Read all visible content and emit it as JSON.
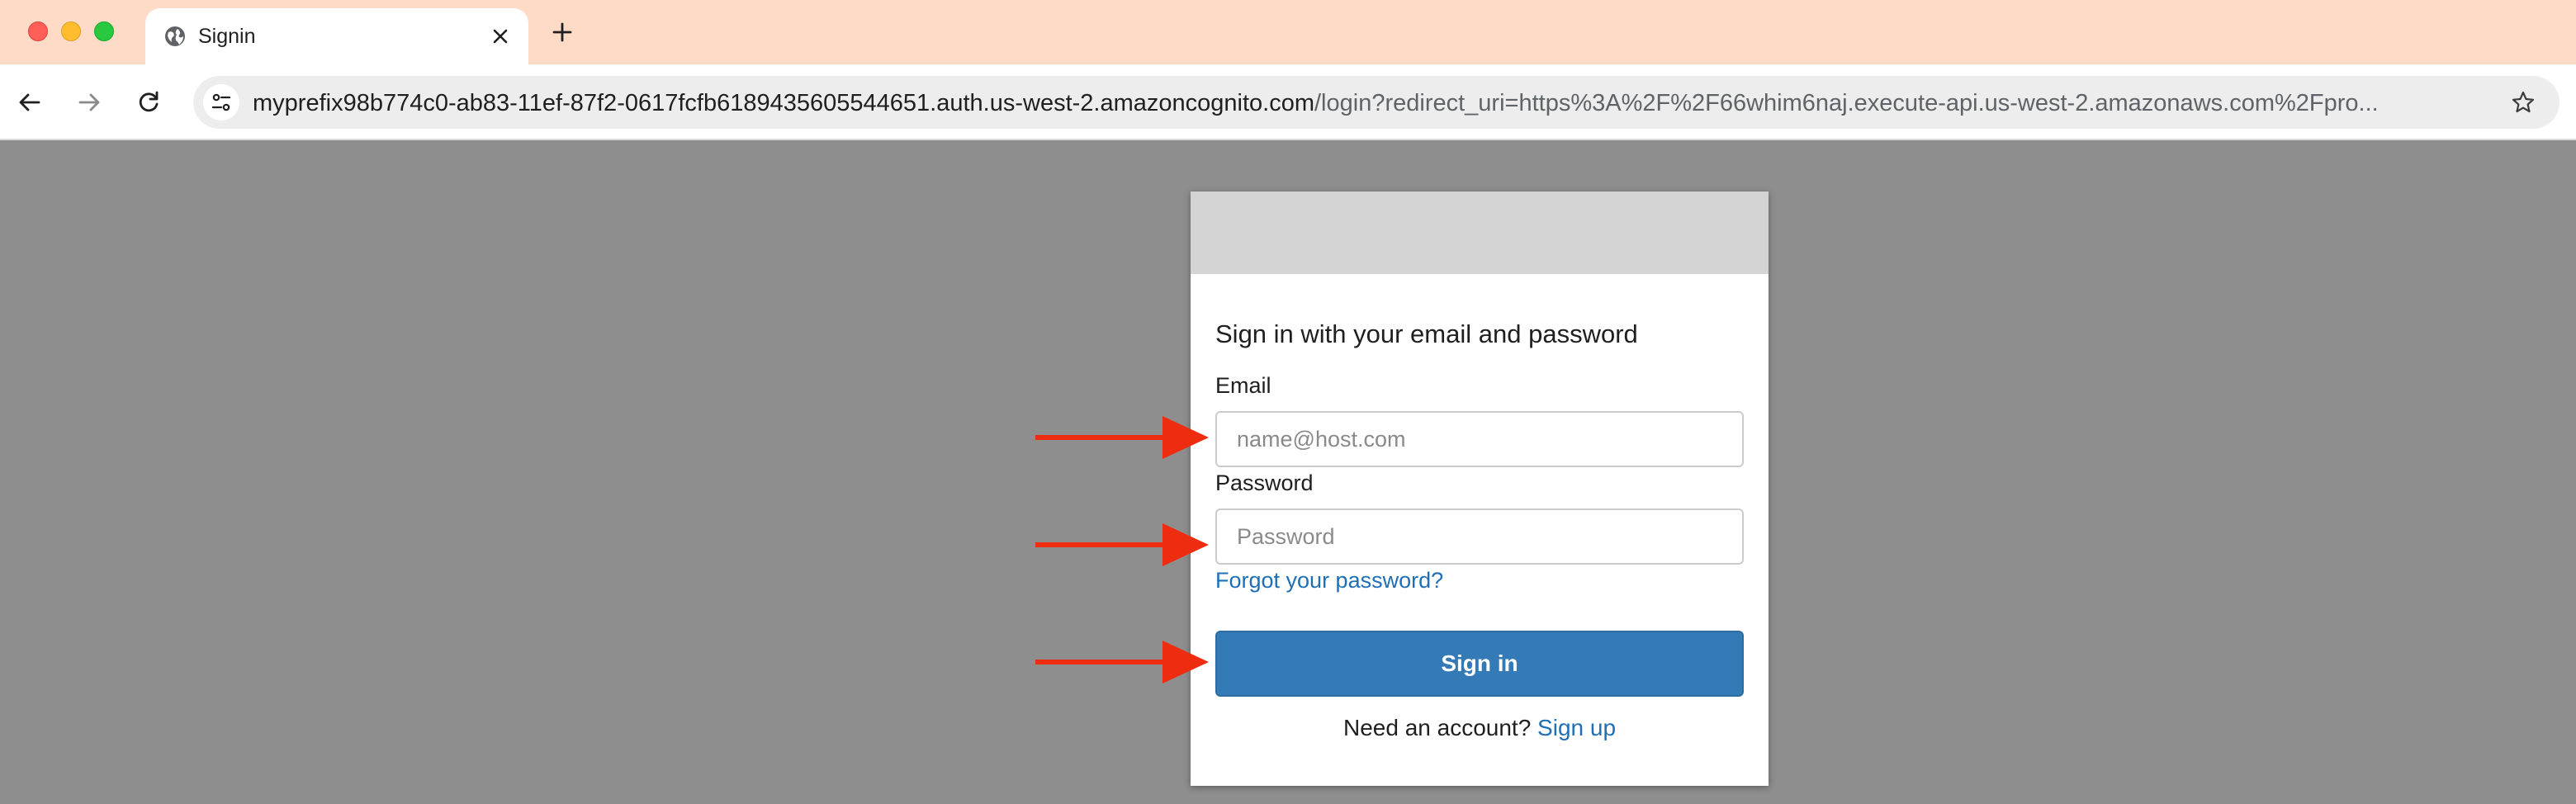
{
  "browser": {
    "tab": {
      "title": "Signin",
      "icon": "globe-icon"
    },
    "new_tab_icon": "plus-icon",
    "address_bar": {
      "host": "myprefix98b774c0-ab83-11ef-87f2-0617fcfb6189435605544651.auth.us-west-2.amazoncognito.com",
      "path": "/login?redirect_uri=https%3A%2F%2F66whim6naj.execute-api.us-west-2.amazonaws.com%2Fpro..."
    },
    "nav_icons": [
      "back-arrow-icon",
      "forward-arrow-icon",
      "reload-icon",
      "site-info-icon",
      "star-icon"
    ]
  },
  "signin": {
    "heading": "Sign in with your email and password",
    "email_label": "Email",
    "email_placeholder": "name@host.com",
    "password_label": "Password",
    "password_placeholder": "Password",
    "forgot_link": "Forgot your password?",
    "submit_label": "Sign in",
    "signup_prompt": "Need an account?",
    "signup_link": "Sign up"
  },
  "colors": {
    "page_background": "#8e8e8e",
    "tabbar_background": "#fddbc7",
    "primary_button": "#337ab7",
    "link": "#1e6fb5",
    "annotation_arrow": "#ee2c10"
  }
}
